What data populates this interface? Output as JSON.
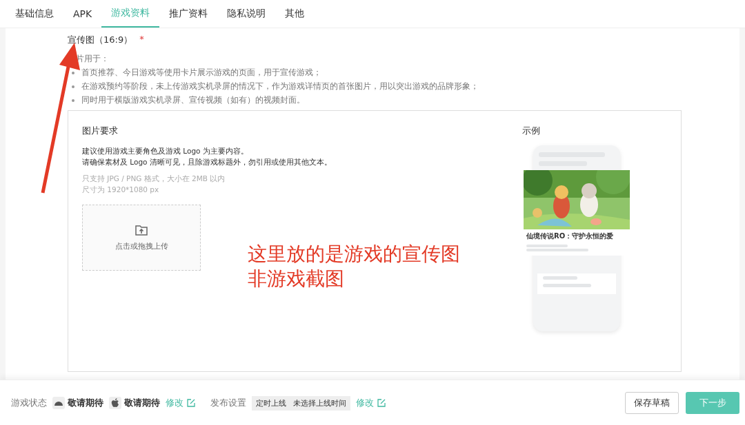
{
  "tabs": [
    {
      "label": "基础信息",
      "selected": false
    },
    {
      "label": "APK",
      "selected": false
    },
    {
      "label": "游戏资料",
      "selected": true
    },
    {
      "label": "推广资料",
      "selected": false
    },
    {
      "label": "隐私说明",
      "selected": false
    },
    {
      "label": "其他",
      "selected": false
    }
  ],
  "field": {
    "label": "宣传图（16:9）",
    "required_mark": "*",
    "usage_title": "片用于：",
    "usage": [
      "首页推荐、今日游戏等使用卡片展示游戏的页面，用于宣传游戏；",
      "在游戏预约等阶段，未上传游戏实机录屏的情况下，作为游戏详情页的首张图片，用以突出游戏的品牌形象；",
      "同时用于横版游戏实机录屏、宣传视频（如有）的视频封面。"
    ]
  },
  "requirements": {
    "title": "图片要求",
    "lines": [
      "建议使用游戏主要角色及游戏 Logo 为主要内容。",
      "请确保素材及 Logo 清晰可见，且除游戏标题外，勿引用或使用其他文本。"
    ],
    "hints": [
      "只支持 JPG / PNG 格式，大小在 2MB 以内",
      "尺寸为 1920*1080 px"
    ],
    "upload": "点击或拖拽上传"
  },
  "example": {
    "title": "示例",
    "card_title": "仙境传说RO：守护永恒的爱"
  },
  "annotation": {
    "lines": [
      "这里放的是游戏的宣传图",
      "非游戏截图"
    ]
  },
  "footer": {
    "status_label": "游戏状态",
    "platforms": [
      {
        "kind": "android",
        "status": "敬请期待"
      },
      {
        "kind": "apple",
        "status": "敬请期待"
      }
    ],
    "edit1": "修改",
    "publish_label": "发布设置",
    "publish_tags": [
      "定时上线",
      "未选择上线时间"
    ],
    "edit2": "修改",
    "buttons": [
      {
        "label": "保存草稿",
        "kind": "secondary"
      },
      {
        "label": "下一步",
        "kind": "primary"
      }
    ]
  }
}
